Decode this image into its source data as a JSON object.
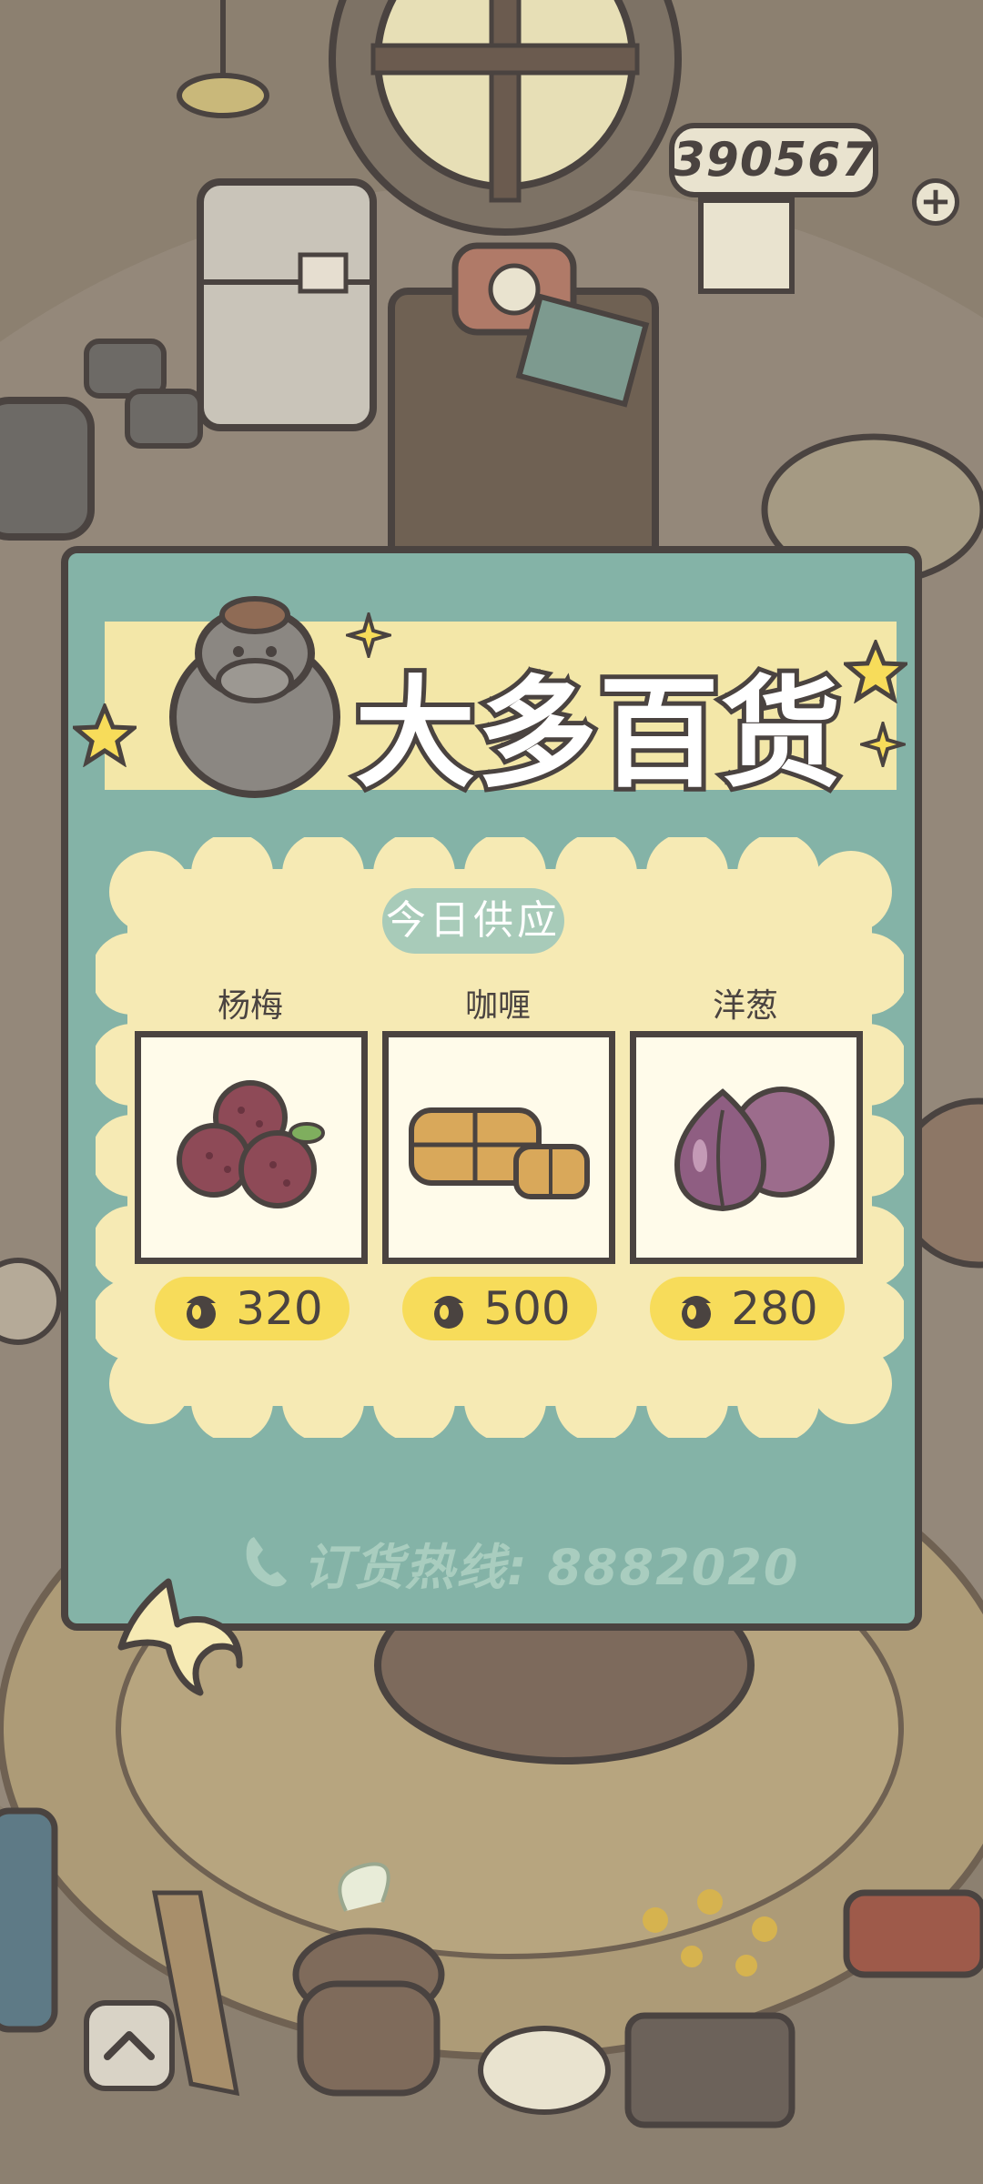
{
  "hud": {
    "acorn_count": "390567",
    "plus_label": "+"
  },
  "shop": {
    "title": "大多百货",
    "today_label": "今日供应",
    "items": [
      {
        "name": "杨梅",
        "price": "320",
        "icon": "bayberry-icon"
      },
      {
        "name": "咖喱",
        "price": "500",
        "icon": "curry-icon"
      },
      {
        "name": "洋葱",
        "price": "280",
        "icon": "onion-icon"
      }
    ],
    "hotline": "订货热线: 8882020",
    "currency_icon": "acorn-icon"
  },
  "colors": {
    "panel": "#84b3a7",
    "title_band": "#f3e7a8",
    "price_pill": "#f7dc5a",
    "outline": "#4a4340"
  }
}
